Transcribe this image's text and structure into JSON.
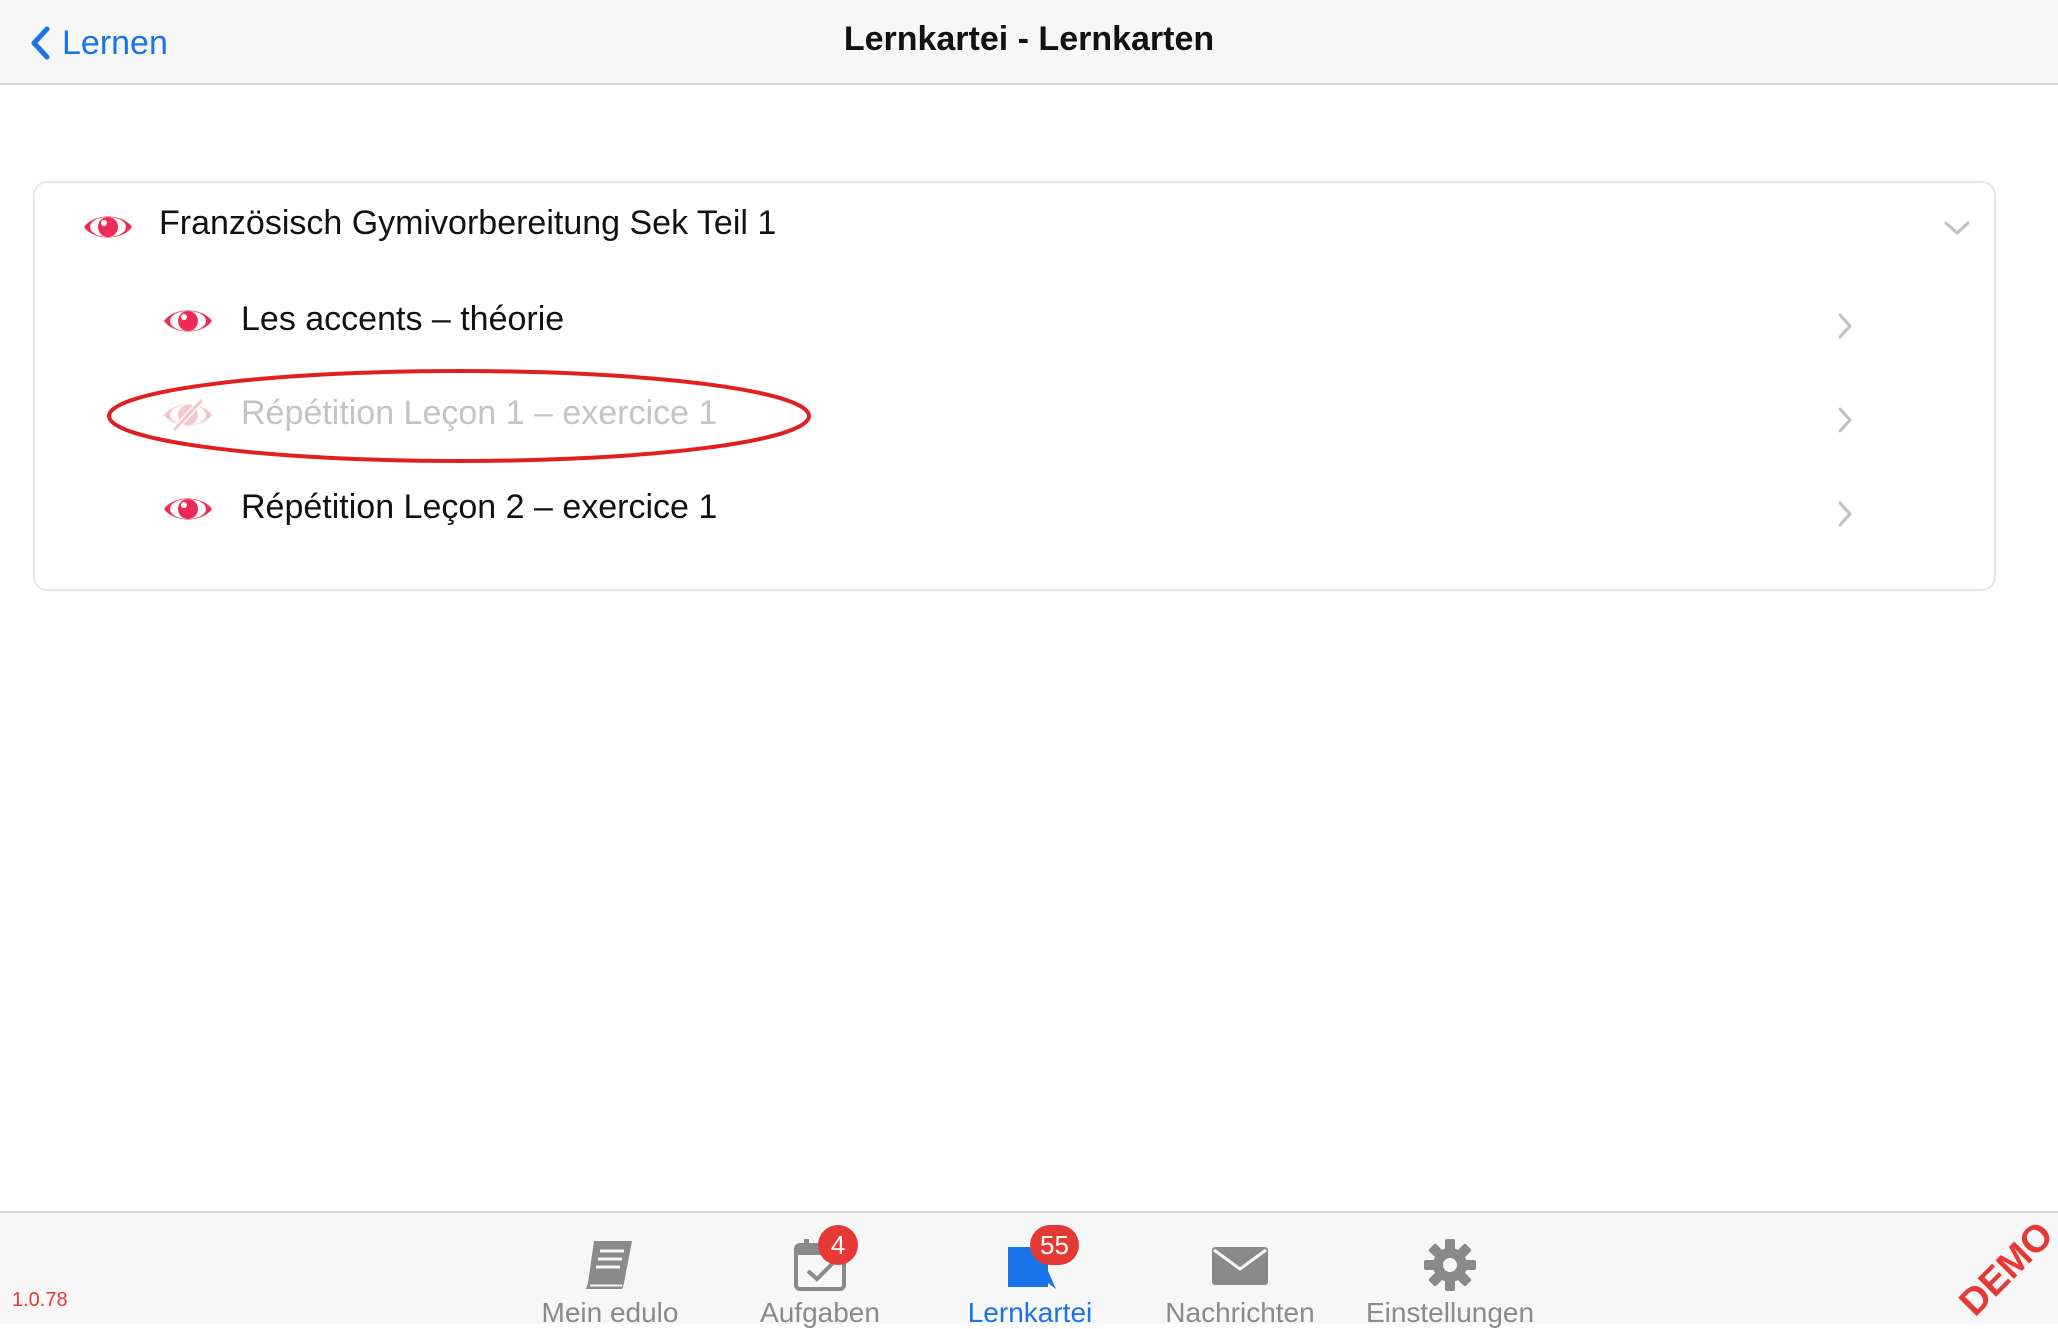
{
  "navbar": {
    "back_label": "Lernen",
    "title": "Lernkartei - Lernkarten"
  },
  "list": {
    "group": {
      "label": "Französisch Gymivorbereitung Sek Teil 1",
      "icon": "eye-icon",
      "expanded": true
    },
    "items": [
      {
        "label": "Les accents – théorie",
        "icon": "eye-icon",
        "hidden": false
      },
      {
        "label": "Répétition Leçon 1 – exercice 1",
        "icon": "eye-slash-icon",
        "hidden": true
      },
      {
        "label": "Répétition Leçon 2 – exercice 1",
        "icon": "eye-icon",
        "hidden": false
      }
    ]
  },
  "tabbar": {
    "version": "1.0.78",
    "tabs": [
      {
        "label": "Mein edulo",
        "icon": "book-icon"
      },
      {
        "label": "Aufgaben",
        "icon": "calendar-check-icon",
        "badge": "4"
      },
      {
        "label": "Lernkartei",
        "icon": "flashcard-icon",
        "badge": "55",
        "active": true
      },
      {
        "label": "Nachrichten",
        "icon": "envelope-icon"
      },
      {
        "label": "Einstellungen",
        "icon": "gear-icon"
      }
    ],
    "watermark": "DEMO"
  },
  "colors": {
    "accent": "#1a73e8",
    "eye": "#ee2b55",
    "badge": "#e53935",
    "annotation": "#e02020"
  }
}
